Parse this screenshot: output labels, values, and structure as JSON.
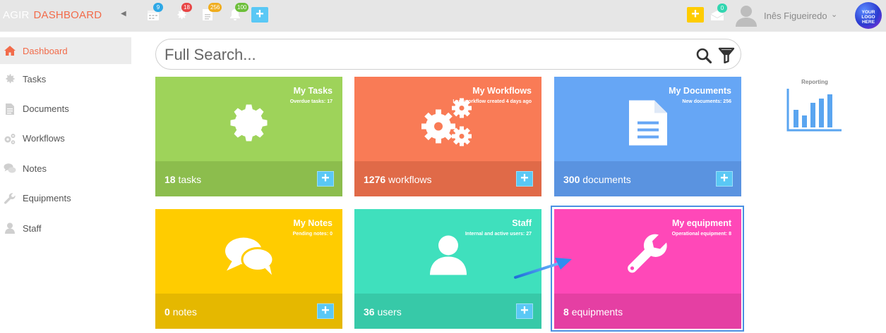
{
  "topbar": {
    "brand": "AGIR",
    "section": "DASHBOARD",
    "badges": {
      "calendar": "9",
      "settings": "18",
      "documents": "256",
      "notifications": "100",
      "messages": "0"
    },
    "user_name": "Inês Figueiredo",
    "logo_text": [
      "YOUR",
      "LOGO",
      "HERE"
    ],
    "colors": {
      "calendar": "#2ea8e6",
      "settings": "#e84545",
      "documents": "#f0ad1e",
      "notifications": "#6dbf3a",
      "messages": "#32d6b0",
      "plus_blue": "#5ac8f5",
      "plus_yellow": "#ffcc00"
    }
  },
  "sidebar": {
    "items": [
      {
        "label": "Dashboard",
        "icon": "home-icon",
        "active": true
      },
      {
        "label": "Tasks",
        "icon": "gear-icon",
        "active": false
      },
      {
        "label": "Documents",
        "icon": "document-icon",
        "active": false
      },
      {
        "label": "Workflows",
        "icon": "gears-icon",
        "active": false
      },
      {
        "label": "Notes",
        "icon": "chat-icon",
        "active": false
      },
      {
        "label": "Equipments",
        "icon": "wrench-icon",
        "active": false
      },
      {
        "label": "Staff",
        "icon": "user-icon",
        "active": false
      }
    ]
  },
  "search": {
    "placeholder": "Full Search..."
  },
  "tiles": [
    {
      "title": "My Tasks",
      "subtitle": "Overdue tasks: 17",
      "count": "18",
      "unit": "tasks",
      "icon": "gear-icon",
      "color": "#9ed35a",
      "footer": "#8cbd4d"
    },
    {
      "title": "My Workflows",
      "subtitle": "Last workflow created 4 days ago",
      "count": "1276",
      "unit": "workflows",
      "icon": "gears-icon",
      "color": "#f97b56",
      "footer": "#e06a48"
    },
    {
      "title": "My Documents",
      "subtitle": "New documents: 256",
      "count": "300",
      "unit": "documents",
      "icon": "document-icon",
      "color": "#66a6f5",
      "footer": "#5a93e0"
    },
    {
      "title": "My Notes",
      "subtitle": "Pending notes: 0",
      "count": "0",
      "unit": "notes",
      "icon": "chat-icon",
      "color": "#ffcc00",
      "footer": "#e5b800"
    },
    {
      "title": "Staff",
      "subtitle": "Internal and active users: 27",
      "count": "36",
      "unit": "users",
      "icon": "user-icon",
      "color": "#3fe0bd",
      "footer": "#37c9a8"
    },
    {
      "title": "My equipment",
      "subtitle": "Operational equipment: 8",
      "count": "8",
      "unit": "equipments",
      "icon": "wrench-icon",
      "color": "#ff48b8",
      "footer": "#e53fa3"
    }
  ],
  "reporting": {
    "label": "Reporting"
  }
}
